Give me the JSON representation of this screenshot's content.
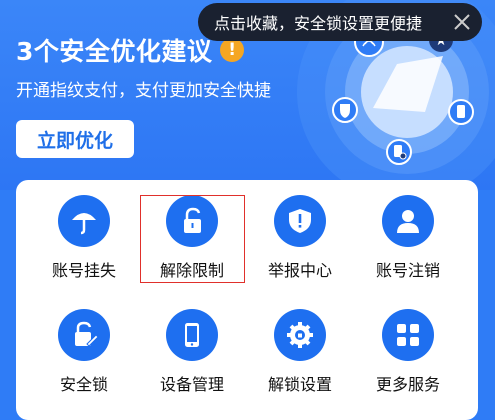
{
  "hero": {
    "title": "3个安全优化建议",
    "warning_icon": "!",
    "subtitle": "开通指纹支付，支付更加安全快捷",
    "cta_label": "立即优化"
  },
  "tooltip": {
    "text": "点击收藏，安全锁设置更便捷"
  },
  "grid": [
    {
      "label": "账号挂失",
      "icon": "umbrella-icon"
    },
    {
      "label": "解除限制",
      "icon": "unlock-icon"
    },
    {
      "label": "举报中心",
      "icon": "shield-alert-icon"
    },
    {
      "label": "账号注销",
      "icon": "user-icon"
    },
    {
      "label": "安全锁",
      "icon": "edit-lock-icon"
    },
    {
      "label": "设备管理",
      "icon": "phone-icon"
    },
    {
      "label": "解锁设置",
      "icon": "gear-icon"
    },
    {
      "label": "更多服务",
      "icon": "grid-icon"
    }
  ],
  "colors": {
    "brand": "#2f7cf6",
    "icon_bg": "#1e6ff0",
    "warning": "#f5a623",
    "highlight": "#e0302b"
  }
}
